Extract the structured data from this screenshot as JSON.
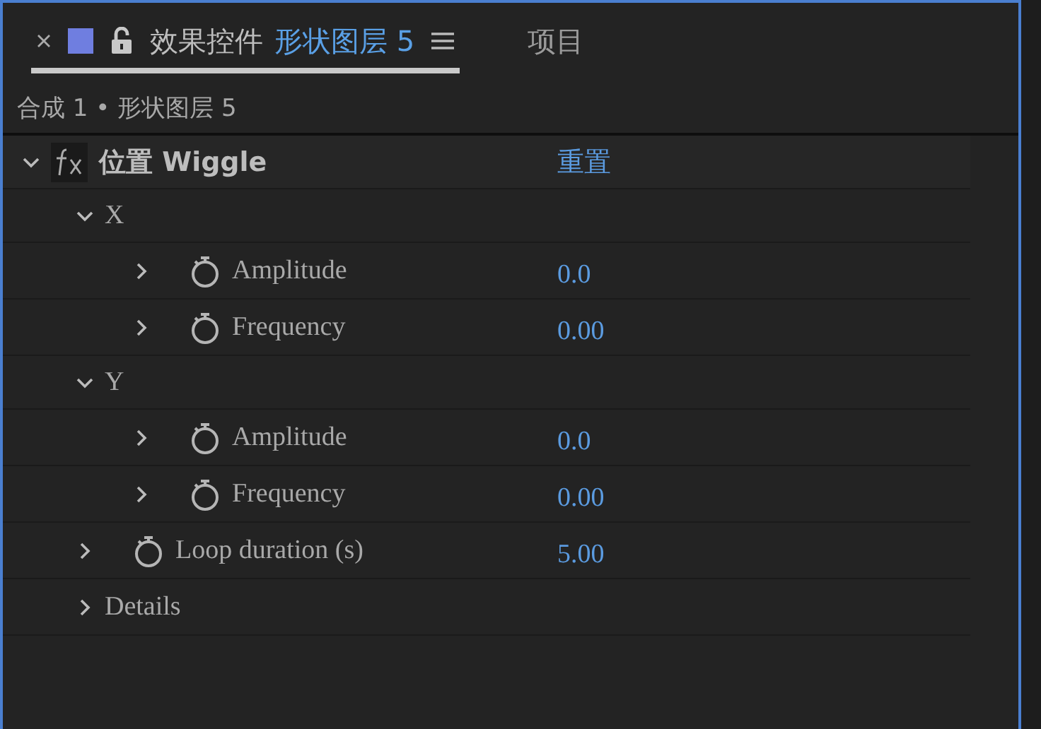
{
  "tabs": [
    {
      "label": "效果控件",
      "layer": "形状图层 5",
      "selected": true,
      "locked": false
    },
    {
      "label": "项目",
      "selected": false
    }
  ],
  "breadcrumb": "合成 1 • 形状图层 5",
  "effects": [
    {
      "name": "位置 Wiggle",
      "reset": "重置",
      "expanded": true,
      "children": [
        {
          "kind": "group",
          "name": "X",
          "expanded": true,
          "children": [
            {
              "kind": "property",
              "name": "Amplitude",
              "value": "0.0",
              "expanded": false
            },
            {
              "kind": "property",
              "name": "Frequency",
              "value": "0.00",
              "expanded": false
            }
          ]
        },
        {
          "kind": "group",
          "name": "Y",
          "expanded": true,
          "children": [
            {
              "kind": "property",
              "name": "Amplitude",
              "value": "0.0",
              "expanded": false
            },
            {
              "kind": "property",
              "name": "Frequency",
              "value": "0.00",
              "expanded": false
            }
          ]
        },
        {
          "kind": "property",
          "name": "Loop duration (s)",
          "value": "5.00",
          "expanded": false
        },
        {
          "kind": "group",
          "name": "Details",
          "expanded": false
        }
      ]
    }
  ]
}
